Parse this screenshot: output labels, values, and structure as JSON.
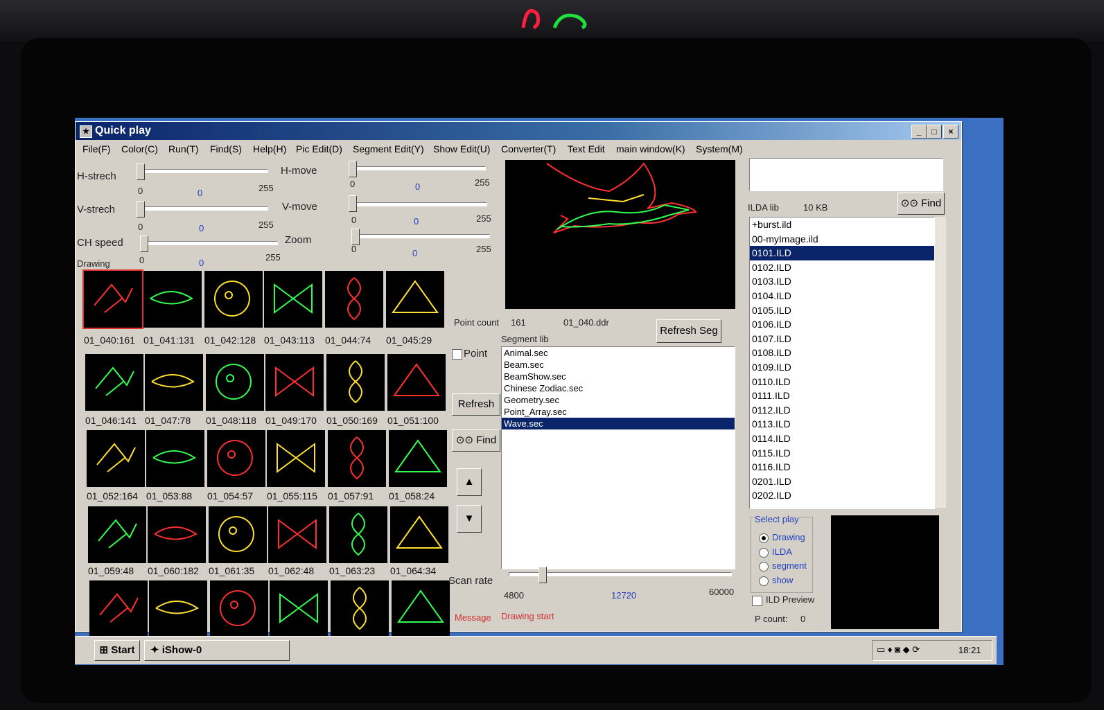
{
  "window": {
    "title": "Quick play",
    "min": "_",
    "max": "□",
    "close": "×"
  },
  "menu": [
    "File(F)",
    "Color(C)",
    "Run(T)",
    "Find(S)",
    "Help(H)",
    "Pic Edit(D)",
    "Segment Edit(Y)",
    "Show Edit(U)",
    "Converter(T)",
    "Text Edit",
    "main window(K)",
    "System(M)"
  ],
  "sliders": {
    "hstrech": {
      "label": "H-strech",
      "min": "0",
      "max": "255",
      "value": "0"
    },
    "vstrech": {
      "label": "V-strech",
      "min": "0",
      "max": "255",
      "value": "0"
    },
    "chspeed": {
      "label": "CH speed",
      "min": "0",
      "max": "255",
      "value": "0",
      "extra_label": "Drawing"
    },
    "hmove": {
      "label": "H-move",
      "min": "0",
      "max": "255",
      "value": "0"
    },
    "vmove": {
      "label": "V-move",
      "min": "0",
      "max": "255",
      "value": "0"
    },
    "zoom": {
      "label": "Zoom",
      "min": "0",
      "max": "255",
      "value": "0"
    }
  },
  "thumbnails": [
    "01_040:161",
    "01_041:131",
    "01_042:128",
    "01_043:113",
    "01_044:74",
    "01_045:29",
    "01_046:141",
    "01_047:78",
    "01_048:118",
    "01_049:170",
    "01_050:169",
    "01_051:100",
    "01_052:164",
    "01_053:88",
    "01_054:57",
    "01_055:115",
    "01_057:91",
    "01_058:24",
    "01_059:48",
    "01_060:182",
    "01_061:35",
    "01_062:48",
    "01_063:23",
    "01_064:34",
    "",
    "",
    "",
    "",
    "",
    ""
  ],
  "point_info": {
    "label": "Point count",
    "count": "161",
    "file": "01_040.ddr"
  },
  "buttons": {
    "refresh_seg": "Refresh Seg",
    "refresh": "Refresh",
    "find": "Find",
    "find_ilda": "Find"
  },
  "point_checkbox": "Point",
  "segment": {
    "label": "Segment lib",
    "items": [
      "Animal.sec",
      "Beam.sec",
      "BeamShow.sec",
      "Chinese Zodiac.sec",
      "Geometry.sec",
      "Point_Array.sec",
      "Wave.sec"
    ],
    "selected": 6
  },
  "scan": {
    "label": "Scan rate",
    "min": "4800",
    "value": "12720",
    "max": "60000"
  },
  "message": {
    "label": "Message",
    "text": "Drawing start"
  },
  "ilda": {
    "label": "ILDA lib",
    "size": "10 KB",
    "items": [
      "+burst.ild",
      "00-myImage.ild",
      "0101.ILD",
      "0102.ILD",
      "0103.ILD",
      "0104.ILD",
      "0105.ILD",
      "0106.ILD",
      "0107.ILD",
      "0108.ILD",
      "0109.ILD",
      "0110.ILD",
      "0111.ILD",
      "0112.ILD",
      "0113.ILD",
      "0114.ILD",
      "0115.ILD",
      "0116.ILD",
      "0201.ILD",
      "0202.ILD"
    ],
    "selected": 2
  },
  "select_play": {
    "label": "Select play",
    "options": [
      "Drawing",
      "ILDA",
      "segment",
      "show"
    ],
    "selected": 0
  },
  "ild_preview": "ILD Preview",
  "pcount": {
    "label": "P count:",
    "value": "0"
  },
  "taskbar": {
    "start": "Start",
    "task": "iShow-0",
    "clock": "18:21"
  }
}
